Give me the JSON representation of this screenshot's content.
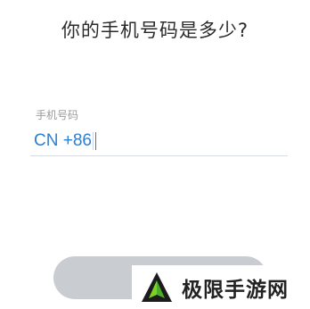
{
  "page": {
    "title": "你的手机号码是多少?"
  },
  "phone_field": {
    "label": "手机号码",
    "country_code": "CN +86",
    "value": ""
  },
  "watermark": {
    "text": "极限手游网"
  },
  "colors": {
    "accent": "#2f7fd0",
    "button_disabled": "#c9ccd1",
    "label": "#9a9a9a"
  }
}
